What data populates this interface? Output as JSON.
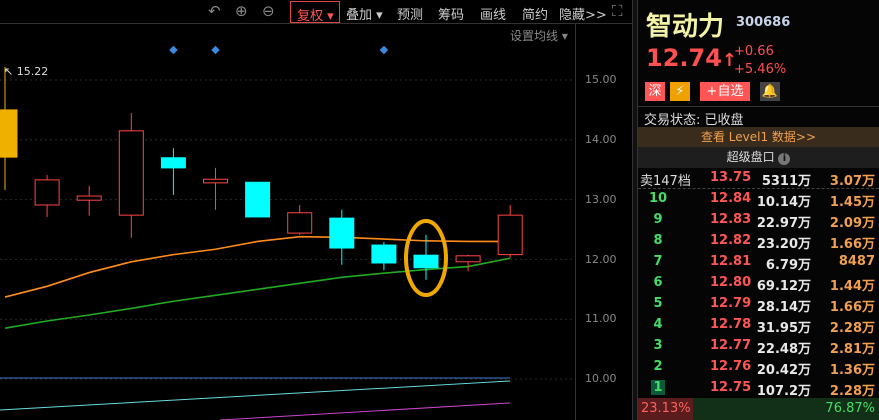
{
  "toolbar": {
    "undo_icon": "undo-icon",
    "zoom_in_icon": "zoom-in-icon",
    "zoom_out_icon": "zoom-out-icon",
    "items": [
      "复权",
      "叠加",
      "预测",
      "筹码",
      "画线",
      "简约",
      "隐藏>>"
    ],
    "fullscreen_icon": "fullscreen-icon"
  },
  "set_ma": "设置均线 ▾",
  "axis_ticks": [
    "15.00",
    "14.00",
    "13.00",
    "12.00",
    "11.00",
    "10.00"
  ],
  "high_label": "15.22",
  "colors": {
    "up": "#ff4444",
    "down": "#00ffff",
    "ma5": "#ff8c1a",
    "ma10": "#22aa22",
    "highlight": "#f0a800"
  },
  "chart_data": {
    "type": "candlestick",
    "ylim": [
      9.7,
      15.6
    ],
    "candles": [
      {
        "o": 13.71,
        "h": 15.22,
        "l": 13.16,
        "c": 14.5,
        "fill": "#f0b000"
      },
      {
        "o": 12.91,
        "h": 13.41,
        "l": 12.71,
        "c": 13.33
      },
      {
        "o": 12.99,
        "h": 13.23,
        "l": 12.73,
        "c": 13.06
      },
      {
        "o": 12.74,
        "h": 14.45,
        "l": 12.36,
        "c": 14.15
      },
      {
        "o": 13.7,
        "h": 13.86,
        "l": 13.08,
        "c": 13.53
      },
      {
        "o": 13.28,
        "h": 13.53,
        "l": 12.83,
        "c": 13.34
      },
      {
        "o": 13.29,
        "h": 13.29,
        "l": 12.71,
        "c": 12.71
      },
      {
        "o": 12.44,
        "h": 12.91,
        "l": 12.41,
        "c": 12.78
      },
      {
        "o": 12.69,
        "h": 12.83,
        "l": 11.91,
        "c": 12.19
      },
      {
        "o": 12.24,
        "h": 12.29,
        "l": 11.82,
        "c": 11.94
      },
      {
        "o": 12.07,
        "h": 12.41,
        "l": 11.66,
        "c": 11.86
      },
      {
        "o": 11.96,
        "h": 12.08,
        "l": 11.8,
        "c": 12.06
      },
      {
        "o": 12.08,
        "h": 12.91,
        "l": 12.03,
        "c": 12.74
      }
    ],
    "ma_orange": [
      11.37,
      11.55,
      11.78,
      11.96,
      12.08,
      12.17,
      12.3,
      12.38,
      12.37,
      12.34,
      12.31,
      12.3,
      12.3
    ],
    "ma_green": [
      10.85,
      10.97,
      11.07,
      11.18,
      11.3,
      11.4,
      11.5,
      11.6,
      11.7,
      11.77,
      11.83,
      11.88,
      12.02
    ],
    "markers_at": [
      4,
      5,
      9
    ],
    "highlight_at": 10
  },
  "stock": {
    "name": "智动力",
    "code": "300686",
    "price": "12.74",
    "arrow": "↑",
    "change": "+0.66",
    "pct": "+5.46%"
  },
  "badges": {
    "market": "深",
    "flash": "⚡",
    "add_watch": "+自选",
    "bell_icon": "bell-icon"
  },
  "state": "交易状态: 已收盘",
  "level1": "查看 Level1 数据>>",
  "super": "超级盘口",
  "sell_total": {
    "label": "卖147档",
    "price": "13.75",
    "vol": "5311万",
    "amt": "3.07万"
  },
  "orders": [
    {
      "lv": "10",
      "price": "12.84",
      "vol": "10.14万",
      "amt": "1.45万"
    },
    {
      "lv": "9",
      "price": "12.83",
      "vol": "22.97万",
      "amt": "2.09万"
    },
    {
      "lv": "8",
      "price": "12.82",
      "vol": "23.20万",
      "amt": "1.66万"
    },
    {
      "lv": "7",
      "price": "12.81",
      "vol": "6.79万",
      "amt": "8487"
    },
    {
      "lv": "6",
      "price": "12.80",
      "vol": "69.12万",
      "amt": "1.44万"
    },
    {
      "lv": "5",
      "price": "12.79",
      "vol": "28.14万",
      "amt": "1.66万"
    },
    {
      "lv": "4",
      "price": "12.78",
      "vol": "31.95万",
      "amt": "2.28万"
    },
    {
      "lv": "3",
      "price": "12.77",
      "vol": "22.48万",
      "amt": "2.81万"
    },
    {
      "lv": "2",
      "price": "12.76",
      "vol": "20.42万",
      "amt": "1.36万"
    },
    {
      "lv": "1",
      "price": "12.75",
      "vol": "107.2万",
      "amt": "2.28万"
    }
  ],
  "ratio": {
    "sell": "23.13%",
    "buy": "76.87%"
  }
}
